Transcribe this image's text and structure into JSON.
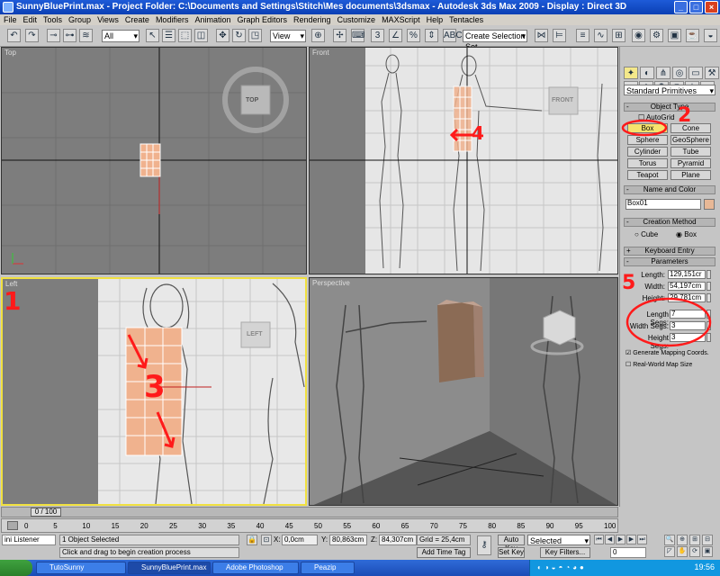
{
  "window": {
    "title": "SunnyBluePrint.max    - Project Folder: C:\\Documents and Settings\\Stitch\\Mes documents\\3dsmax    - Autodesk 3ds Max  2009     - Display : Direct 3D"
  },
  "menu": [
    "File",
    "Edit",
    "Tools",
    "Group",
    "Views",
    "Create",
    "Modifiers",
    "Animation",
    "Graph Editors",
    "Rendering",
    "Customize",
    "MAXScript",
    "Help",
    "Tentacles"
  ],
  "toolbar": {
    "selection_filter": "All",
    "reference_coord": "View",
    "named_selection": "Create Selection Set"
  },
  "viewports": {
    "top": {
      "label": "Top",
      "cube": "TOP"
    },
    "front": {
      "label": "Front",
      "cube": "FRONT"
    },
    "left": {
      "label": "Left",
      "cube": "LEFT"
    },
    "perspective": {
      "label": "Perspective"
    }
  },
  "command_panel": {
    "category": "Standard Primitives",
    "object_type": {
      "title": "Object Type",
      "autogrid": "AutoGrid",
      "buttons": [
        "Box",
        "Cone",
        "Sphere",
        "GeoSphere",
        "Cylinder",
        "Tube",
        "Torus",
        "Pyramid",
        "Teapot",
        "Plane"
      ]
    },
    "name_color": {
      "title": "Name and Color",
      "name": "Box01",
      "color": "#e8b896"
    },
    "creation_method": {
      "title": "Creation Method",
      "options": [
        "Cube",
        "Box"
      ],
      "selected": "Box"
    },
    "keyboard_entry": "Keyboard Entry",
    "parameters": {
      "title": "Parameters",
      "length_label": "Length:",
      "length": "129,151cr",
      "width_label": "Width:",
      "width": "54,197cm",
      "height_label": "Height:",
      "height": "29,781cm",
      "length_segs_label": "Length Segs:",
      "length_segs": "7",
      "width_segs_label": "Width Segs:",
      "width_segs": "3",
      "height_segs_label": "Height Segs:",
      "height_segs": "3",
      "gen_mapping": "Generate Mapping Coords.",
      "gen_mapping_checked": true,
      "realworld": "Real-World Map Size",
      "realworld_checked": false
    }
  },
  "timeline": {
    "slider": "0 / 100",
    "ticks": [
      "0",
      "5",
      "10",
      "15",
      "20",
      "25",
      "30",
      "35",
      "40",
      "45",
      "50",
      "55",
      "60",
      "65",
      "70",
      "75",
      "80",
      "85",
      "90",
      "95",
      "100"
    ]
  },
  "status": {
    "listener": "ini Listener",
    "selected": "1 Object Selected",
    "prompt": "Click and drag to begin creation process",
    "x_label": "X:",
    "x": "0,0cm",
    "y_label": "Y:",
    "y": "80,863cm",
    "z_label": "Z:",
    "z": "84,307cm",
    "grid": "Grid = 25,4cm",
    "add_time_tag": "Add Time Tag",
    "auto_key": "Auto Key",
    "selected_dropdown": "Selected",
    "set_key": "Set Key",
    "key_filters": "Key Filters...",
    "frame": "0"
  },
  "taskbar": {
    "items": [
      "TutoSunny",
      "SunnyBluePrint.max",
      "Adobe Photoshop",
      "Peazip"
    ],
    "active": "SunnyBluePrint.max",
    "clock": "19:56"
  },
  "annotations": [
    "1",
    "2",
    "3",
    "4",
    "5"
  ]
}
